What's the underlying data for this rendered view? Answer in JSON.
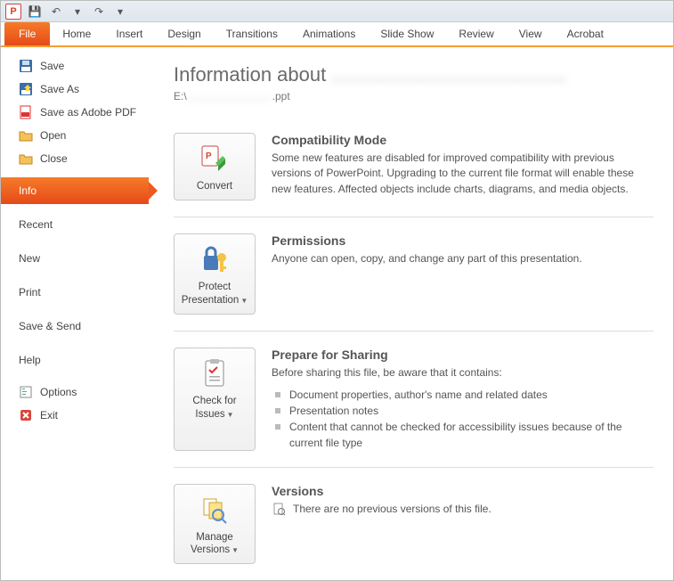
{
  "qat": {
    "save": "💾",
    "undo": "↶",
    "redo": "↷",
    "drop": "▾"
  },
  "ribbon": {
    "file": "File",
    "tabs": [
      "Home",
      "Insert",
      "Design",
      "Transitions",
      "Animations",
      "Slide Show",
      "Review",
      "View",
      "Acrobat"
    ]
  },
  "sidebar": {
    "file_ops": [
      {
        "label": "Save",
        "icon": "save"
      },
      {
        "label": "Save As",
        "icon": "saveas"
      },
      {
        "label": "Save as Adobe PDF",
        "icon": "pdf"
      },
      {
        "label": "Open",
        "icon": "open"
      },
      {
        "label": "Close",
        "icon": "close"
      }
    ],
    "headings": [
      "Info",
      "Recent",
      "New",
      "Print",
      "Save & Send",
      "Help"
    ],
    "active": "Info",
    "bottom": [
      {
        "label": "Options",
        "icon": "options"
      },
      {
        "label": "Exit",
        "icon": "exit"
      }
    ]
  },
  "info": {
    "title_prefix": "Information about ",
    "title_redacted": "………………………………",
    "path_prefix": "E:\\",
    "path_redacted": "……………………",
    "path_suffix": ".ppt",
    "sections": {
      "convert": {
        "btn": "Convert",
        "head": "Compatibility Mode",
        "text": "Some new features are disabled for improved compatibility with previous versions of PowerPoint. Upgrading to the current file format will enable these new features. Affected objects include charts, diagrams, and media objects."
      },
      "protect": {
        "btn": "Protect Presentation",
        "head": "Permissions",
        "text": "Anyone can open, copy, and change any part of this presentation."
      },
      "check": {
        "btn": "Check for Issues",
        "head": "Prepare for Sharing",
        "intro": "Before sharing this file, be aware that it contains:",
        "items": [
          "Document properties, author's name and related dates",
          "Presentation notes",
          "Content that cannot be checked for accessibility issues because of the current file type"
        ]
      },
      "versions": {
        "btn": "Manage Versions",
        "head": "Versions",
        "text": "There are no previous versions of this file."
      }
    }
  }
}
